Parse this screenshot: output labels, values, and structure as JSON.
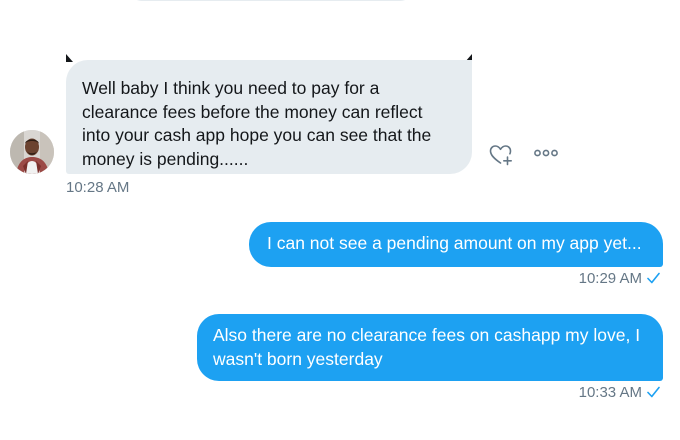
{
  "conversation": {
    "incoming": {
      "text": "Well baby I think you need to pay for a clearance fees before the money can reflect into your cash app hope you can see that the money is pending......",
      "lines": [
        "Well baby I think you need to pay for a",
        "clearance fees before the money can reflect",
        "into your cash app hope you can see that the",
        "money is pending......"
      ],
      "timestamp": "10:28 AM"
    },
    "outgoing": [
      {
        "lines": [
          "I can not see a pending amount on my app yet..."
        ],
        "timestamp": "10:29 AM"
      },
      {
        "lines": [
          "Also there are no clearance fees on cashapp my love, I",
          "wasn't born yesterday"
        ],
        "timestamp": "10:33 AM"
      }
    ]
  },
  "icons": {
    "heart_action": "heart-plus-icon",
    "more_action": "more-options-icon",
    "read_receipt": "checkmark-icon"
  },
  "colors": {
    "incoming_bubble": "#e6ecf0",
    "outgoing_bubble": "#1da1f2",
    "timestamp": "#657786",
    "accent": "#1da1f2"
  }
}
